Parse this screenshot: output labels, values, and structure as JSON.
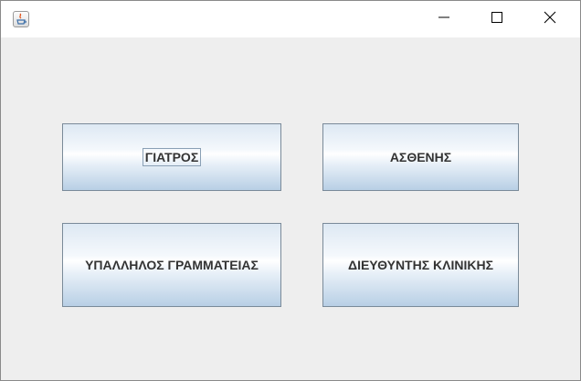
{
  "window": {
    "icon": "java-cup-icon",
    "controls": {
      "minimize_icon": "minimize-icon",
      "maximize_icon": "maximize-icon",
      "close_icon": "close-icon"
    }
  },
  "buttons": {
    "doctor": "ΓΙΑΤΡΟΣ",
    "patient": "ΑΣΘΕΝΗΣ",
    "clerk": "ΥΠΑΛΛΗΛΟΣ ΓΡΑΜΜΑΤΕΙΑΣ",
    "director": "ΔΙΕΥΘΥΝΤΗΣ ΚΛΙΝΙΚΗΣ"
  },
  "colors": {
    "background": "#eeeeee",
    "titlebar": "#ffffff",
    "button_text": "#333333",
    "button_border": "#7a8a99"
  }
}
